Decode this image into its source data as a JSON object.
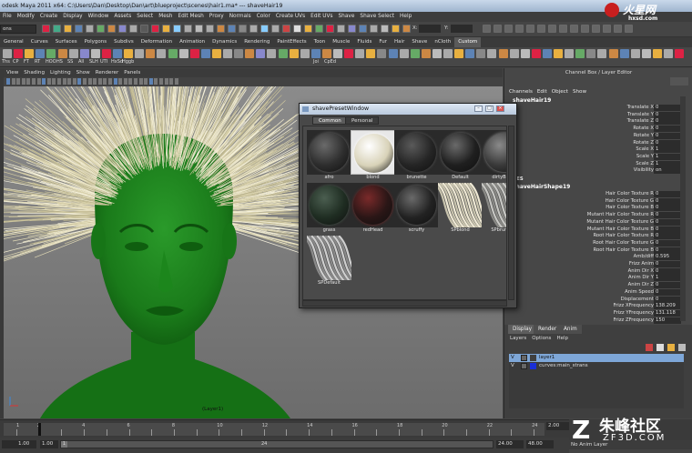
{
  "window": {
    "title": "odesk Maya 2011 x64: C:\\Users\\Dan\\Desktop\\Dan\\art\\blueproject\\scenes\\hair1.ma* --- shaveHair19"
  },
  "menubar": [
    "File",
    "Modify",
    "Create",
    "Display",
    "Window",
    "Assets",
    "Select",
    "Mesh",
    "Edit Mesh",
    "Proxy",
    "Normals",
    "Color",
    "Create UVs",
    "Edit UVs",
    "Shave",
    "Shave Select",
    "Help"
  ],
  "statusline": {
    "mode": "ons",
    "x_label": "X:",
    "y_label": "Y:"
  },
  "shelf_tabs": [
    "General",
    "Curves",
    "Surfaces",
    "Polygons",
    "Subdivs",
    "Deformation",
    "Animation",
    "Dynamics",
    "Rendering",
    "PaintEffects",
    "Toon",
    "Muscle",
    "Fluids",
    "Fur",
    "Hair",
    "Shave",
    "nCloth",
    "Custom"
  ],
  "shelf_active_tab": "Custom",
  "shelf_labels": [
    "Ths",
    "CP",
    "FT",
    "RT",
    "HOO",
    "HS",
    "SS",
    "All",
    "SLH",
    "UTI",
    "HxSd",
    "Hggb",
    "Joi",
    "CpEd"
  ],
  "viewport": {
    "menu": [
      "View",
      "Shading",
      "Lighting",
      "Show",
      "Renderer",
      "Panels"
    ],
    "hud_label": "(Layer1)"
  },
  "channel_box": {
    "title": "Channel Box / Layer Editor",
    "menu": [
      "Channels",
      "Edit",
      "Object",
      "Show"
    ],
    "node_name": "shaveHair19",
    "transform": [
      {
        "label": "Translate X",
        "value": "0"
      },
      {
        "label": "Translate Y",
        "value": "0"
      },
      {
        "label": "Translate Z",
        "value": "0"
      },
      {
        "label": "Rotate X",
        "value": "0"
      },
      {
        "label": "Rotate Y",
        "value": "0"
      },
      {
        "label": "Rotate Z",
        "value": "0"
      },
      {
        "label": "Scale X",
        "value": "1"
      },
      {
        "label": "Scale Y",
        "value": "1"
      },
      {
        "label": "Scale Z",
        "value": "1"
      },
      {
        "label": "Visibility",
        "value": "on"
      }
    ],
    "shapes_header": "PES",
    "shape_name": "shaveHairShape19",
    "shape_attrs": [
      {
        "label": "Hair Color Texture R",
        "value": "0"
      },
      {
        "label": "Hair Color Texture G",
        "value": "0"
      },
      {
        "label": "Hair Color Texture B",
        "value": "0"
      },
      {
        "label": "Mutant Hair Color Texture R",
        "value": "0"
      },
      {
        "label": "Mutant Hair Color Texture G",
        "value": "0"
      },
      {
        "label": "Mutant Hair Color Texture B",
        "value": "0"
      },
      {
        "label": "Root Hair Color Texture R",
        "value": "0"
      },
      {
        "label": "Root Hair Color Texture G",
        "value": "0"
      },
      {
        "label": "Root Hair Color Texture B",
        "value": "0"
      },
      {
        "label": "Amb/diff",
        "value": "0.595"
      },
      {
        "label": "Frizz Anim",
        "value": "0"
      },
      {
        "label": "Anim Dir X",
        "value": "0"
      },
      {
        "label": "Anim Dir Y",
        "value": "1"
      },
      {
        "label": "Anim Dir Z",
        "value": "0"
      },
      {
        "label": "Anim Speed",
        "value": "0"
      },
      {
        "label": "Displacement",
        "value": "0"
      },
      {
        "label": "Frizz XFrequency",
        "value": "138.209"
      },
      {
        "label": "Frizz YFrequency",
        "value": "131.118"
      },
      {
        "label": "Frizz ZFrequency",
        "value": "150"
      }
    ]
  },
  "layer_editor": {
    "tabs": [
      "Display",
      "Render",
      "Anim"
    ],
    "menu": [
      "Layers",
      "Options",
      "Help"
    ],
    "layers": [
      {
        "v": "V",
        "name": "layer1",
        "color": "#3f3f3f",
        "selected": true
      },
      {
        "v": "V",
        "name": "curves:main_strans",
        "color": "#1a2fd6",
        "selected": false
      }
    ]
  },
  "preset_window": {
    "title": "shavePresetWindow",
    "tabs": [
      "Common",
      "Personal"
    ],
    "active_tab": "Common",
    "presets": [
      {
        "name": "afro",
        "style": "ball",
        "color": "#2e2e2e",
        "hl": "#6a6a6a"
      },
      {
        "name": "blond",
        "style": "ball",
        "color": "#d8d2b8",
        "hl": "#ffffff",
        "selected": true
      },
      {
        "name": "brunette",
        "style": "ball",
        "color": "#252525",
        "hl": "#5a5a5a"
      },
      {
        "name": "Default",
        "style": "ball",
        "color": "#1f1f1f",
        "hl": "#6a6a6a"
      },
      {
        "name": "dirtyBlond",
        "style": "ball",
        "color": "#3a3a3a",
        "hl": "#8a8a8a"
      },
      {
        "name": "grass",
        "style": "ball",
        "color": "#1f2d22",
        "hl": "#4b5e50"
      },
      {
        "name": "redHead",
        "style": "ball",
        "color": "#2a1616",
        "hl": "#7a2a2a"
      },
      {
        "name": "scruffy",
        "style": "ball",
        "color": "#222222",
        "hl": "#6a6a6a"
      },
      {
        "name": "SPblond",
        "style": "strands",
        "color": "#c9c4ae",
        "hl": "#efe9d4"
      },
      {
        "name": "SPbrunette",
        "style": "strands",
        "color": "#8a8a86",
        "hl": "#c8c8c4"
      },
      {
        "name": "SPDefault",
        "style": "strands",
        "color": "#8a8a8a",
        "hl": "#cfcfcf"
      }
    ]
  },
  "timeline": {
    "ticks": [
      "1",
      "2",
      "4",
      "6",
      "8",
      "10",
      "12",
      "14",
      "16",
      "18",
      "20",
      "22",
      "24"
    ],
    "current_frame": "2.00"
  },
  "range": {
    "start": "1.00",
    "range_start": "1.00",
    "range_mid": "1",
    "range_end_marker": "24",
    "end": "24.00",
    "anim_end": "48.00",
    "anim_layer": "No Anim Layer"
  },
  "watermark": {
    "top": "火星网",
    "top_sub": "hxsd.com",
    "bottom": "朱峰社区",
    "bottom_sub": "ZF3D.COM"
  },
  "colors": {
    "face": "#1b7a1b",
    "hair": "#e6e1c2",
    "accent": "#5d83b5"
  }
}
